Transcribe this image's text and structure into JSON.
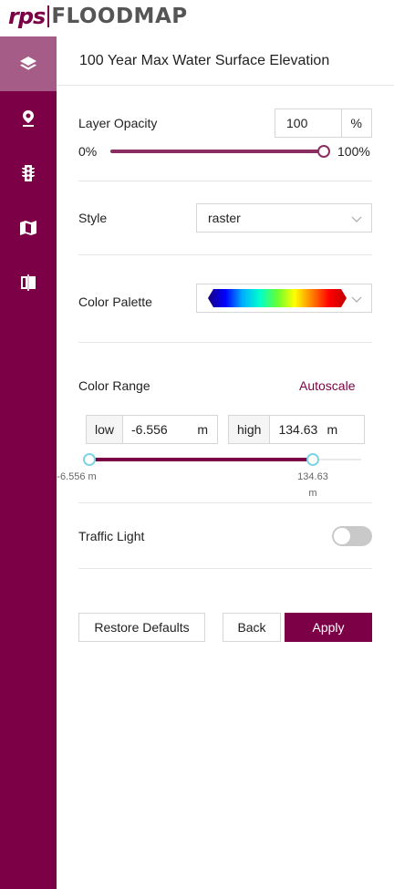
{
  "app": {
    "logo_rps": "rps",
    "logo_flood": "FLOODMAP"
  },
  "sidebar": {
    "items": [
      {
        "icon": "layers-icon",
        "active": true
      },
      {
        "icon": "map-pin-icon",
        "active": false
      },
      {
        "icon": "traffic-light-icon",
        "active": false
      },
      {
        "icon": "map-icon",
        "active": false
      },
      {
        "icon": "compare-icon",
        "active": false
      }
    ]
  },
  "panel": {
    "title": "100 Year Max Water Surface Elevation",
    "opacity": {
      "label": "Layer Opacity",
      "value": "100",
      "unit": "%",
      "min_label": "0%",
      "max_label": "100%",
      "percent": 100
    },
    "style": {
      "label": "Style",
      "value": "raster"
    },
    "palette": {
      "label": "Color Palette",
      "colors": [
        "#1a0080",
        "#0000ff",
        "#00b0ff",
        "#00ffcc",
        "#66ff33",
        "#ffff00",
        "#ff8000",
        "#ff0000",
        "#c00000"
      ]
    },
    "color_range": {
      "label": "Color Range",
      "autoscale": "Autoscale",
      "low_prefix": "low",
      "low_value": "-6.556",
      "high_prefix": "high",
      "high_value": "134.63",
      "unit": "m",
      "low_tick": "-6.556 m",
      "high_tick_line1": "134.63",
      "high_tick_line2": "m"
    },
    "traffic_light": {
      "label": "Traffic Light",
      "enabled": false
    },
    "buttons": {
      "restore": "Restore Defaults",
      "back": "Back",
      "apply": "Apply"
    }
  },
  "colors": {
    "brand": "#7b0046",
    "active_sidebar": "#a55c86",
    "slider": "#8a2e62",
    "range_knob": "#7fd3e6"
  }
}
